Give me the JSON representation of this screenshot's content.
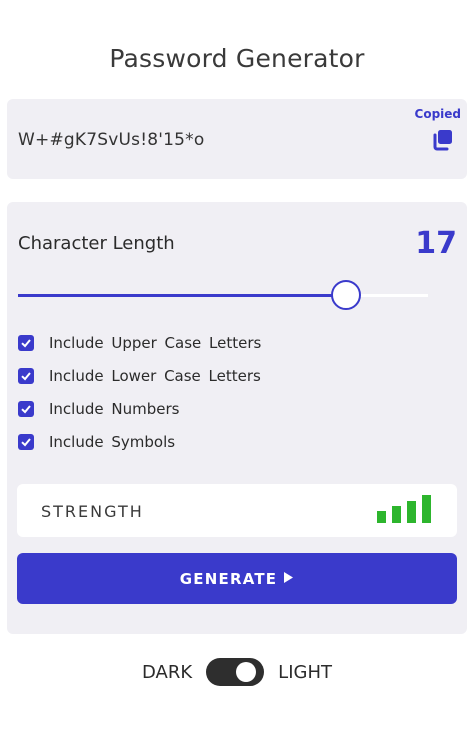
{
  "app": {
    "title": "Password Generator"
  },
  "password": {
    "value": "W+#gK7SvUs!8'15*o",
    "copied_label": "Copied",
    "copy_icon": "copy-icon"
  },
  "length": {
    "label": "Character Length",
    "value": "17",
    "slider_fraction": 0.8
  },
  "options": [
    {
      "label": "Include Upper Case Letters",
      "checked": true
    },
    {
      "label": "Include Lower Case Letters",
      "checked": true
    },
    {
      "label": "Include Numbers",
      "checked": true
    },
    {
      "label": "Include Symbols",
      "checked": true
    }
  ],
  "strength": {
    "label": "STRENGTH",
    "bars_filled": 4,
    "bars_total": 4,
    "color": "#2db52d"
  },
  "generate": {
    "label": "GENERATE",
    "icon": "play-arrow-icon"
  },
  "theme": {
    "dark_label": "DARK",
    "light_label": "LIGHT",
    "mode": "light"
  },
  "colors": {
    "accent": "#3a3acb",
    "card_bg": "#f0eff4",
    "strength_green": "#2db52d"
  }
}
